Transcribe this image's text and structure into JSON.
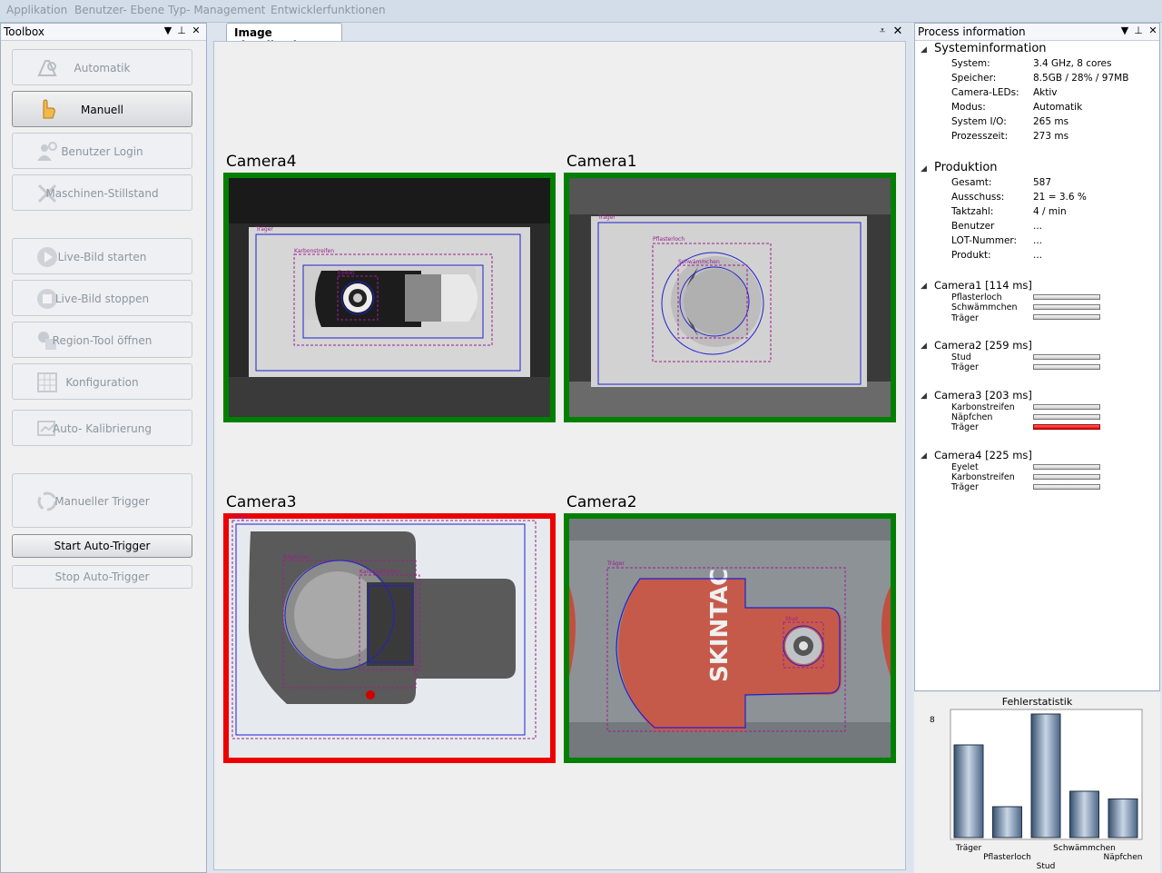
{
  "menu": [
    "Applikation",
    "Benutzer- Ebene",
    "Typ- Management",
    "Entwicklerfunktionen"
  ],
  "toolbox": {
    "title": "Toolbox",
    "buttons": [
      "Automatik",
      "Manuell",
      "Benutzer Login",
      "Maschinen-Stillstand",
      "Live-Bild starten",
      "Live-Bild stoppen",
      "Region-Tool öffnen",
      "Konfiguration",
      "Auto- Kalibrierung",
      "Manueller Trigger"
    ],
    "start_auto": "Start Auto-Trigger",
    "stop_auto": "Stop Auto-Trigger"
  },
  "viz": {
    "tab": "Image visualization",
    "cameras": [
      {
        "name": "Camera4",
        "status_color": "#008000",
        "labels": [
          "Träger",
          "Karbonstreifen",
          "Eyelet"
        ]
      },
      {
        "name": "Camera1",
        "status_color": "#008000",
        "labels": [
          "Träger",
          "Pflasterloch",
          "Schwämmchen"
        ]
      },
      {
        "name": "Camera3",
        "status_color": "#ee0000",
        "labels": [
          "Träger",
          "Näpfchen",
          "Karbonstreifen"
        ]
      },
      {
        "name": "Camera2",
        "status_color": "#008000",
        "labels": [
          "Träger",
          "Stud"
        ]
      }
    ]
  },
  "process": {
    "title": "Process information",
    "system": {
      "title": "Systeminformation",
      "rows": [
        {
          "k": "System:",
          "v": "3.4 GHz, 8 cores"
        },
        {
          "k": "Speicher:",
          "v": "8.5GB / 28% / 97MB"
        },
        {
          "k": "Camera-LEDs:",
          "v": "Aktiv"
        },
        {
          "k": "Modus:",
          "v": "Automatik"
        },
        {
          "k": "System I/O:",
          "v": "265 ms"
        },
        {
          "k": "Prozesszeit:",
          "v": "273 ms"
        }
      ]
    },
    "production": {
      "title": "Produktion",
      "rows": [
        {
          "k": "Gesamt:",
          "v": "587"
        },
        {
          "k": "Ausschuss:",
          "v": "21 = 3.6 %"
        },
        {
          "k": "Taktzahl:",
          "v": "4 / min"
        },
        {
          "k": "Benutzer",
          "v": "..."
        },
        {
          "k": "LOT-Nummer:",
          "v": "..."
        },
        {
          "k": "Produkt:",
          "v": "..."
        }
      ]
    },
    "cams": [
      {
        "title": "Camera1 [114 ms]",
        "items": [
          {
            "n": "Pflasterloch",
            "fail": false
          },
          {
            "n": "Schwämmchen",
            "fail": false
          },
          {
            "n": "Träger",
            "fail": false
          }
        ]
      },
      {
        "title": "Camera2 [259 ms]",
        "items": [
          {
            "n": "Stud",
            "fail": false
          },
          {
            "n": "Träger",
            "fail": false
          }
        ]
      },
      {
        "title": "Camera3 [203 ms]",
        "items": [
          {
            "n": "Karbonstreifen",
            "fail": false
          },
          {
            "n": "Näpfchen",
            "fail": false
          },
          {
            "n": "Träger",
            "fail": true
          }
        ]
      },
      {
        "title": "Camera4 [225 ms]",
        "items": [
          {
            "n": "Eyelet",
            "fail": false
          },
          {
            "n": "Karbonstreifen",
            "fail": false
          },
          {
            "n": "Träger",
            "fail": false
          }
        ]
      }
    ]
  },
  "chart_data": {
    "type": "bar",
    "title": "Fehlerstatistik",
    "categories": [
      "Träger",
      "Pflasterloch",
      "Stud",
      "Schwämmchen",
      "Näpfchen"
    ],
    "values": [
      6,
      2,
      8,
      3,
      2.5
    ],
    "ymax_label": "8",
    "ylim": [
      0,
      8
    ]
  }
}
